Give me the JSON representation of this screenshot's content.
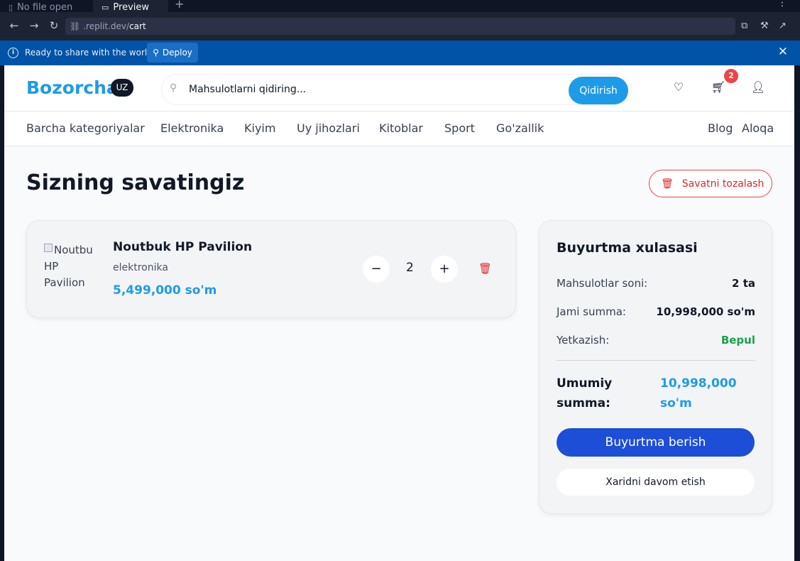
{
  "browser": {
    "tabs": [
      {
        "label": "No file open",
        "icon": "file-icon"
      },
      {
        "label": "Preview",
        "icon": "monitor-icon"
      }
    ],
    "new_tab": "+",
    "url_prefix": ".replit.dev/",
    "url_path": "cart",
    "deploy_banner": {
      "message": "Ready to share with the world?",
      "button": "Deploy"
    }
  },
  "header": {
    "logo": "Bozorcha",
    "lang": "UZ",
    "search_placeholder": "Mahsulotlarni qidiring...",
    "search_button": "Qidirish",
    "cart_count": "2"
  },
  "categories": {
    "items": [
      "Barcha kategoriyalar",
      "Elektronika",
      "Kiyim",
      "Uy jihozlari",
      "Kitoblar",
      "Sport",
      "Go'zallik"
    ],
    "right": [
      "Blog",
      "Aloqa"
    ]
  },
  "main": {
    "title": "Sizning savatingiz",
    "clear_button": "Savatni tozalash"
  },
  "cart_item": {
    "image_alt": "Noutbuk HP Pavilion",
    "name": "Noutbuk HP Pavilion",
    "category": "elektronika",
    "price": "5,499,000 so'm",
    "quantity": "2"
  },
  "summary": {
    "title": "Buyurtma xulasasi",
    "items_label": "Mahsulotlar soni:",
    "items_value": "2 ta",
    "sum_label": "Jami summa:",
    "sum_value": "10,998,000 so'm",
    "delivery_label": "Yetkazish:",
    "delivery_value": "Bepul",
    "total_label": "Umumiy summa:",
    "total_value": "10,998,000 so'm",
    "order_button": "Buyurtma berish",
    "continue_button": "Xaridni davom etish"
  },
  "colors": {
    "brand": "#1e9be8",
    "danger": "#dc2626",
    "success": "#16a34a",
    "primary_button": "#1d4ed8"
  }
}
